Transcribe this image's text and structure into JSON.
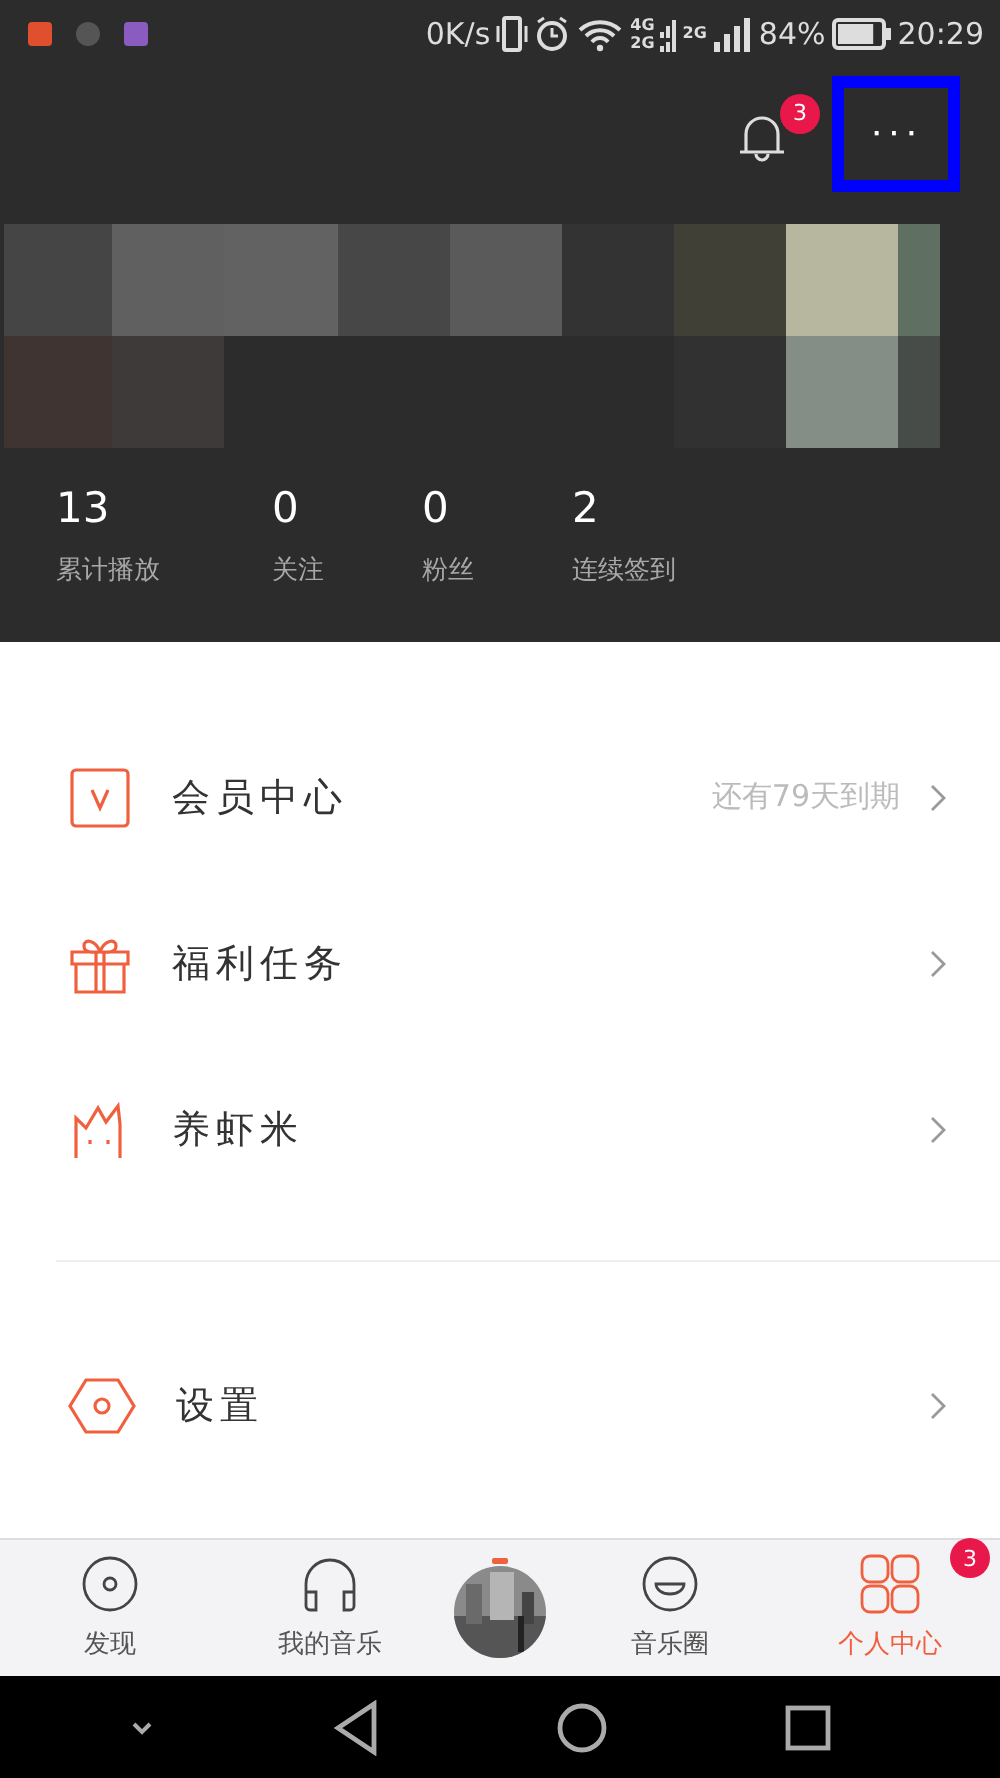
{
  "status_bar": {
    "speed": "0K/s",
    "network_top": "4G",
    "network_bottom": "2G",
    "network2": "2G",
    "battery_text": "84%",
    "time": "20:29"
  },
  "header": {
    "notification_badge": "3",
    "more_button": {
      "label": "···",
      "highlighted": true
    }
  },
  "stats": [
    {
      "value": "13",
      "label": "累计播放"
    },
    {
      "value": "0",
      "label": "关注"
    },
    {
      "value": "0",
      "label": "粉丝"
    },
    {
      "value": "2",
      "label": "连续签到"
    }
  ],
  "menu": [
    {
      "kind": "vip",
      "label": "会员中心",
      "note": "还有79天到期"
    },
    {
      "kind": "gift",
      "label": "福利任务"
    },
    {
      "kind": "cat",
      "label": "养虾米"
    }
  ],
  "settings": {
    "kind": "settings",
    "label": "设置"
  },
  "tabs": [
    {
      "kind": "disc",
      "label": "发现",
      "selected": false
    },
    {
      "kind": "headphones",
      "label": "我的音乐",
      "selected": false
    },
    {
      "kind": "player"
    },
    {
      "kind": "smile",
      "label": "音乐圈",
      "selected": false
    },
    {
      "kind": "grid",
      "label": "个人中心",
      "selected": true,
      "badge": "3"
    }
  ]
}
